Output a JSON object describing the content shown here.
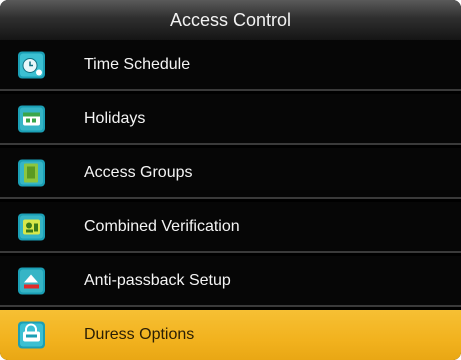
{
  "title": "Access Control",
  "selected_index": 5,
  "items": [
    {
      "label": "Time Schedule",
      "icon": "clock-icon"
    },
    {
      "label": "Holidays",
      "icon": "holiday-icon"
    },
    {
      "label": "Access Groups",
      "icon": "group-icon"
    },
    {
      "label": "Combined Verification",
      "icon": "verification-icon"
    },
    {
      "label": "Anti-passback Setup",
      "icon": "anti-passback-icon"
    },
    {
      "label": "Duress Options",
      "icon": "duress-icon"
    }
  ],
  "colors": {
    "background": "#000000",
    "selected": "#f2b21e",
    "icon_teal": "#1ea3b8",
    "icon_green": "#3aa64a"
  }
}
